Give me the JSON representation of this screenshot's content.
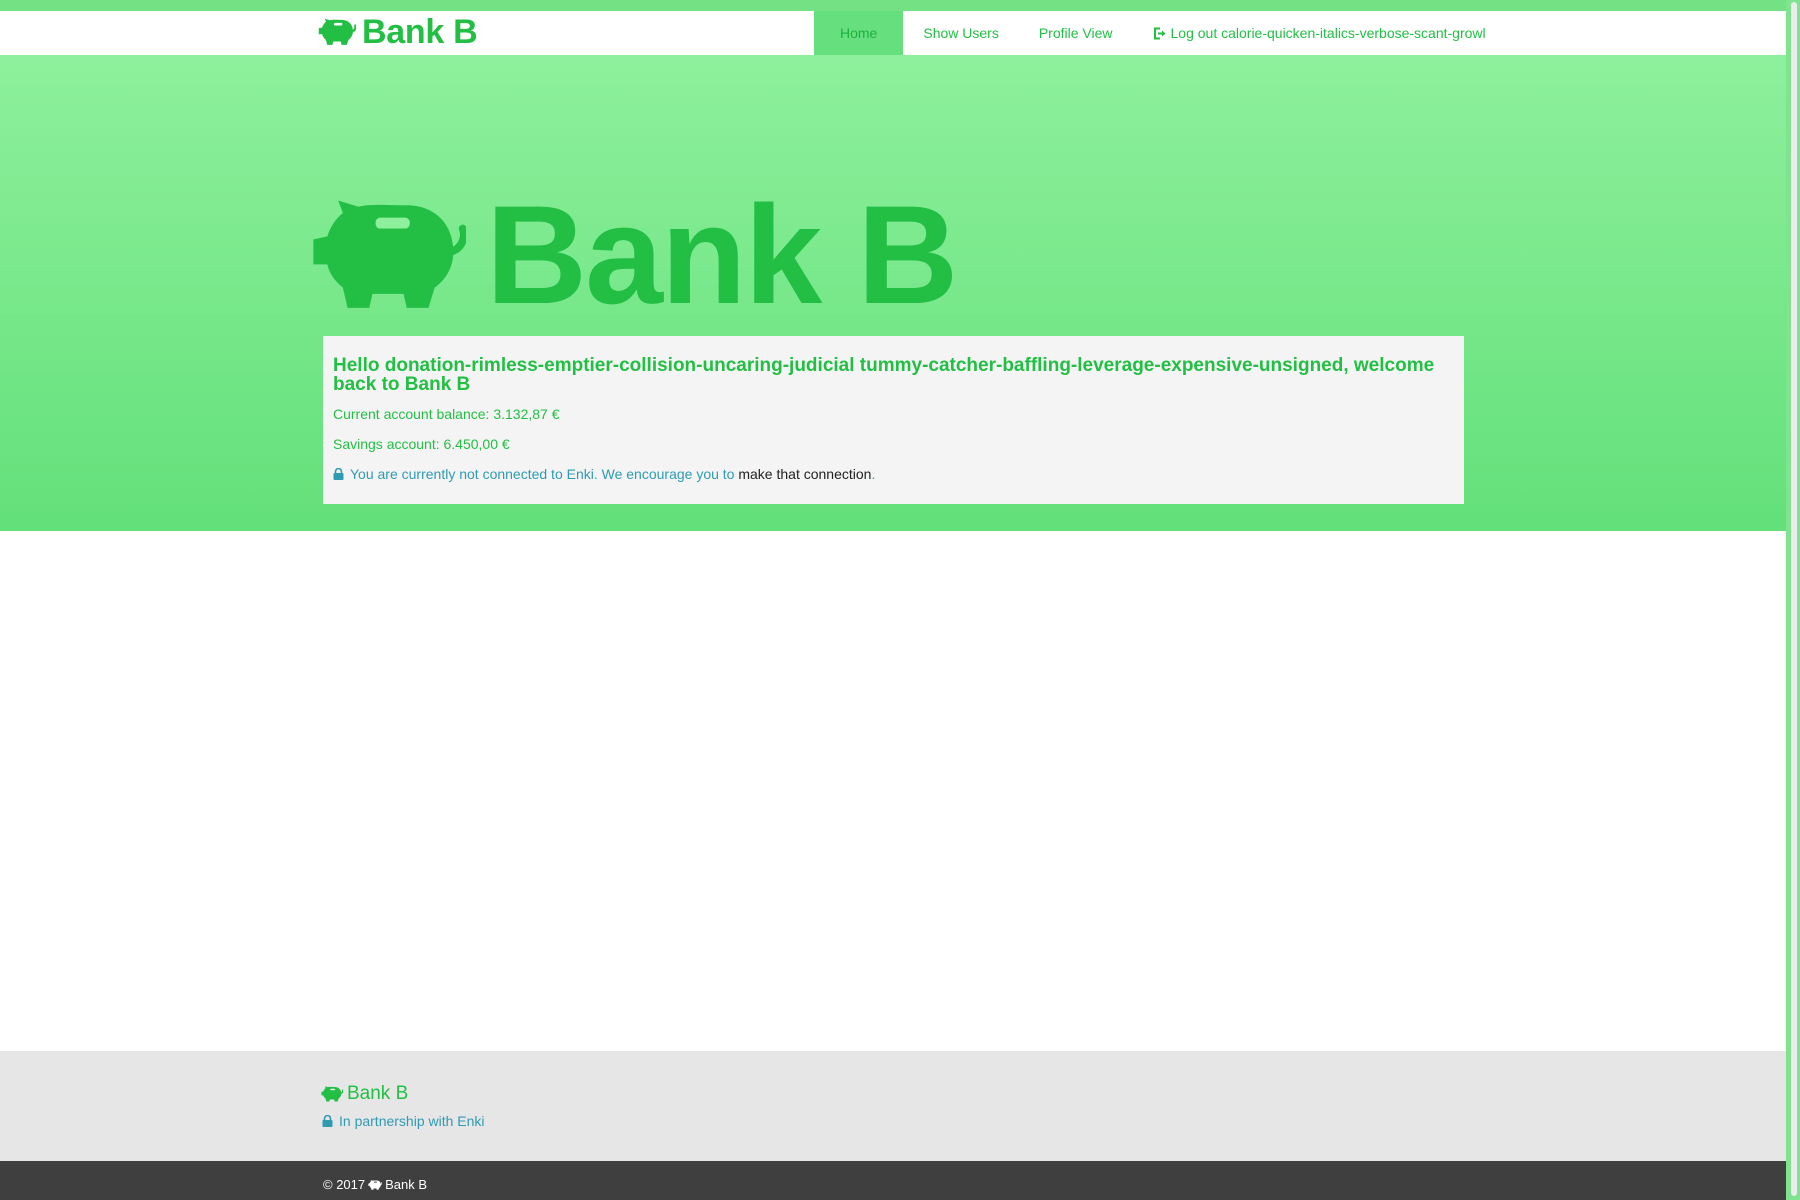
{
  "colors": {
    "brand_green": "#22bf44",
    "jumbo_top": "#8ef09c",
    "jumbo_bottom": "#63e07a",
    "link_blue": "#2f9bb3",
    "footer_bg": "#e6e6e6",
    "bottom_bar_bg": "#3f3f3f"
  },
  "navbar": {
    "brand": {
      "icon": "piggy-bank-icon",
      "label": "Bank B"
    },
    "items": [
      {
        "label": "Home",
        "active": true
      },
      {
        "label": "Show Users"
      },
      {
        "label": "Profile View"
      },
      {
        "label": "Log out calorie-quicken-italics-verbose-scant-growl",
        "icon": "logout-icon"
      }
    ]
  },
  "hero": {
    "icon": "piggy-bank-icon",
    "title": "Bank B"
  },
  "account": {
    "greeting": "Hello donation-rimless-emptier-collision-uncaring-judicial tummy-catcher-baffling-leverage-expensive-unsigned, welcome back to Bank B",
    "current_balance": "Current account balance: 3.132,87 €",
    "savings": "Savings account: 6.450,00 €",
    "enki_icon": "lock-icon",
    "enki_notice": "You are currently not connected to Enki. We encourage you to",
    "enki_link": "make that connection",
    "enki_end": "."
  },
  "footer": {
    "brand": "Bank B",
    "partnership_icon": "lock-icon",
    "partnership": "In partnership with Enki",
    "copyright_prefix": "© 2017",
    "copyright_brand": "Bank B"
  }
}
